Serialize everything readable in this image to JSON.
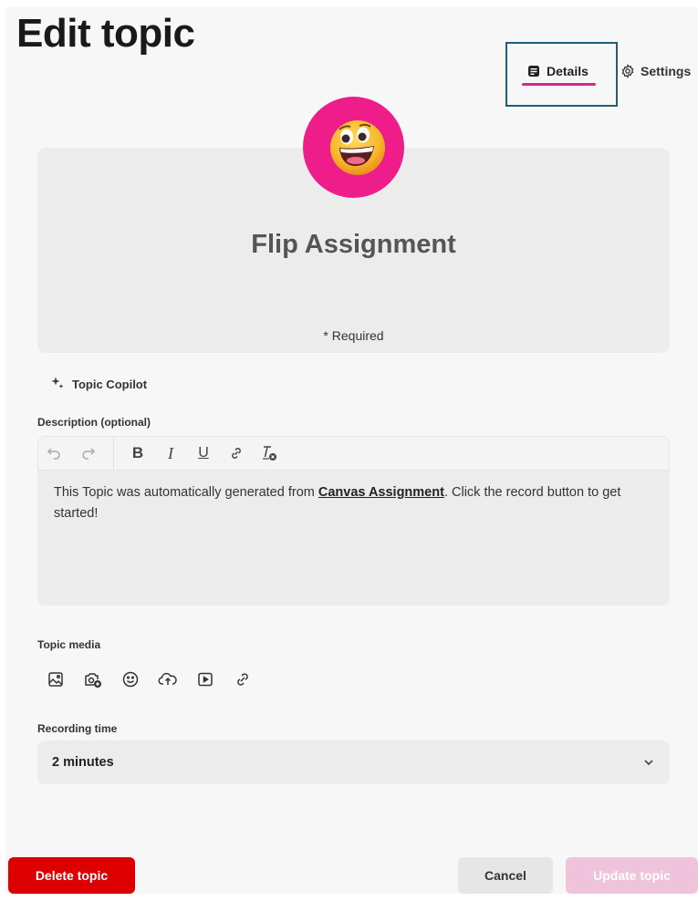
{
  "page": {
    "title": "Edit topic"
  },
  "tabs": [
    {
      "label": "Details",
      "icon": "details-icon",
      "active": true
    },
    {
      "label": "Settings",
      "icon": "gear-icon",
      "active": false
    }
  ],
  "cover": {
    "avatar_icon": "grinning-face-emoji",
    "avatar_bg": "#ee1d8a",
    "topic_title": "Flip Assignment",
    "required_note": "* Required"
  },
  "copilot": {
    "label": "Topic Copilot",
    "icon": "sparkle-icon"
  },
  "description": {
    "label": "Description (optional)",
    "toolbar": [
      "undo-icon",
      "redo-icon",
      "bold-icon",
      "italic-icon",
      "underline-icon",
      "link-icon",
      "clear-format-icon"
    ],
    "bold_glyph": "B",
    "italic_glyph": "I",
    "underline_glyph": "U",
    "text_before": "This Topic was automatically generated from ",
    "link_text": "Canvas Assignment",
    "text_after": ". Click the record button to get started!"
  },
  "media": {
    "label": "Topic media",
    "icons": [
      "image-icon",
      "camera-add-icon",
      "emoji-icon",
      "upload-cloud-icon",
      "video-icon",
      "link-icon"
    ]
  },
  "recording": {
    "label": "Recording time",
    "value": "2 minutes"
  },
  "actions": {
    "delete_label": "Delete topic",
    "cancel_label": "Cancel",
    "update_label": "Update topic"
  },
  "colors": {
    "accent": "#d4268f",
    "delete": "#dd0000",
    "update_disabled": "#f0c3dd",
    "highlight_border": "#1e5f74"
  }
}
